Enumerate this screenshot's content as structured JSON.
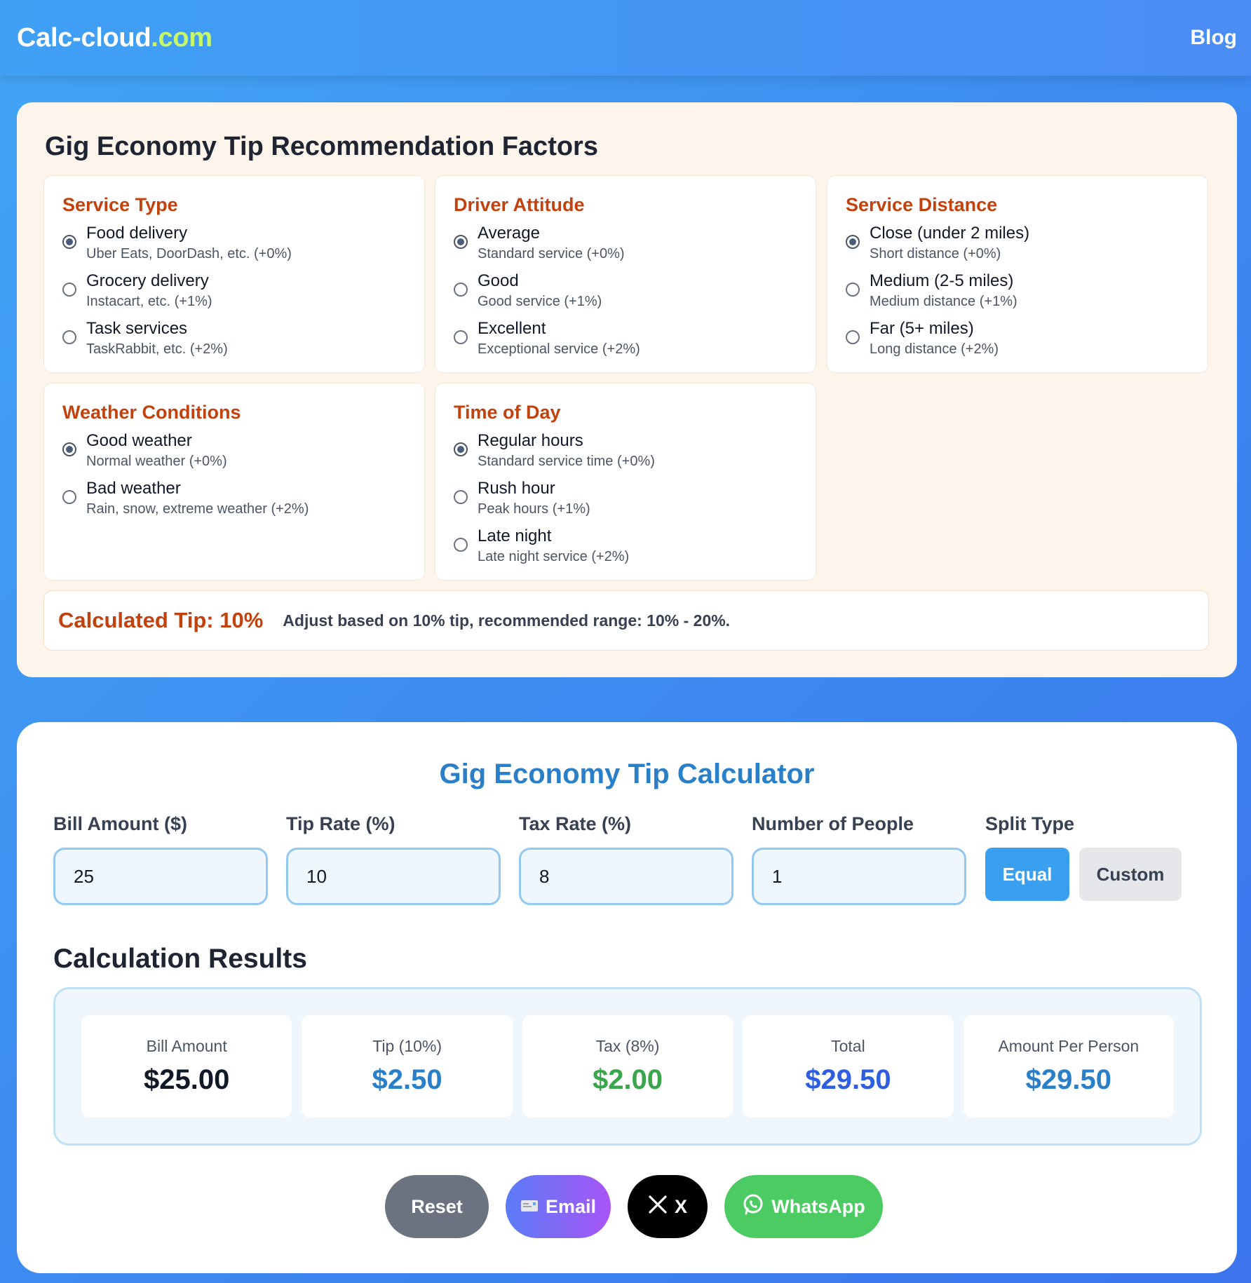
{
  "header": {
    "logo_main": "Calc-cloud",
    "logo_tld": ".com",
    "nav_blog": "Blog"
  },
  "factors": {
    "title": "Gig Economy Tip Recommendation Factors",
    "groups": [
      {
        "title": "Service Type",
        "options": [
          {
            "label": "Food delivery",
            "desc": "Uber Eats, DoorDash, etc. (+0%)",
            "selected": true
          },
          {
            "label": "Grocery delivery",
            "desc": "Instacart, etc. (+1%)",
            "selected": false
          },
          {
            "label": "Task services",
            "desc": "TaskRabbit, etc. (+2%)",
            "selected": false
          }
        ]
      },
      {
        "title": "Driver Attitude",
        "options": [
          {
            "label": "Average",
            "desc": "Standard service (+0%)",
            "selected": true
          },
          {
            "label": "Good",
            "desc": "Good service (+1%)",
            "selected": false
          },
          {
            "label": "Excellent",
            "desc": "Exceptional service (+2%)",
            "selected": false
          }
        ]
      },
      {
        "title": "Service Distance",
        "options": [
          {
            "label": "Close (under 2 miles)",
            "desc": "Short distance (+0%)",
            "selected": true
          },
          {
            "label": "Medium (2-5 miles)",
            "desc": "Medium distance (+1%)",
            "selected": false
          },
          {
            "label": "Far (5+ miles)",
            "desc": "Long distance (+2%)",
            "selected": false
          }
        ]
      },
      {
        "title": "Weather Conditions",
        "options": [
          {
            "label": "Good weather",
            "desc": "Normal weather (+0%)",
            "selected": true
          },
          {
            "label": "Bad weather",
            "desc": "Rain, snow, extreme weather (+2%)",
            "selected": false
          }
        ]
      },
      {
        "title": "Time of Day",
        "options": [
          {
            "label": "Regular hours",
            "desc": "Standard service time (+0%)",
            "selected": true
          },
          {
            "label": "Rush hour",
            "desc": "Peak hours (+1%)",
            "selected": false
          },
          {
            "label": "Late night",
            "desc": "Late night service (+2%)",
            "selected": false
          }
        ]
      }
    ],
    "calculated_tip": "Calculated Tip: 10%",
    "advice": "Adjust based on 10% tip, recommended range: 10% - 20%."
  },
  "calculator": {
    "title": "Gig Economy Tip Calculator",
    "fields": {
      "bill": {
        "label": "Bill Amount ($)",
        "value": "25"
      },
      "tip": {
        "label": "Tip Rate (%)",
        "value": "10"
      },
      "tax": {
        "label": "Tax Rate (%)",
        "value": "8"
      },
      "people": {
        "label": "Number of People",
        "value": "1"
      }
    },
    "split": {
      "label": "Split Type",
      "equal": "Equal",
      "custom": "Custom",
      "selected": "Equal"
    },
    "results_title": "Calculation Results",
    "results": [
      {
        "label": "Bill Amount",
        "value": "$25.00",
        "color": "#111827"
      },
      {
        "label": "Tip (10%)",
        "value": "$2.50",
        "color": "#2a7fc9"
      },
      {
        "label": "Tax (8%)",
        "value": "$2.00",
        "color": "#3aa64c"
      },
      {
        "label": "Total",
        "value": "$29.50",
        "color": "#2f5fe0"
      },
      {
        "label": "Amount Per Person",
        "value": "$29.50",
        "color": "#2a7fc9"
      }
    ],
    "actions": {
      "reset": "Reset",
      "email": "Email",
      "x": "X",
      "whatsapp": "WhatsApp"
    }
  }
}
